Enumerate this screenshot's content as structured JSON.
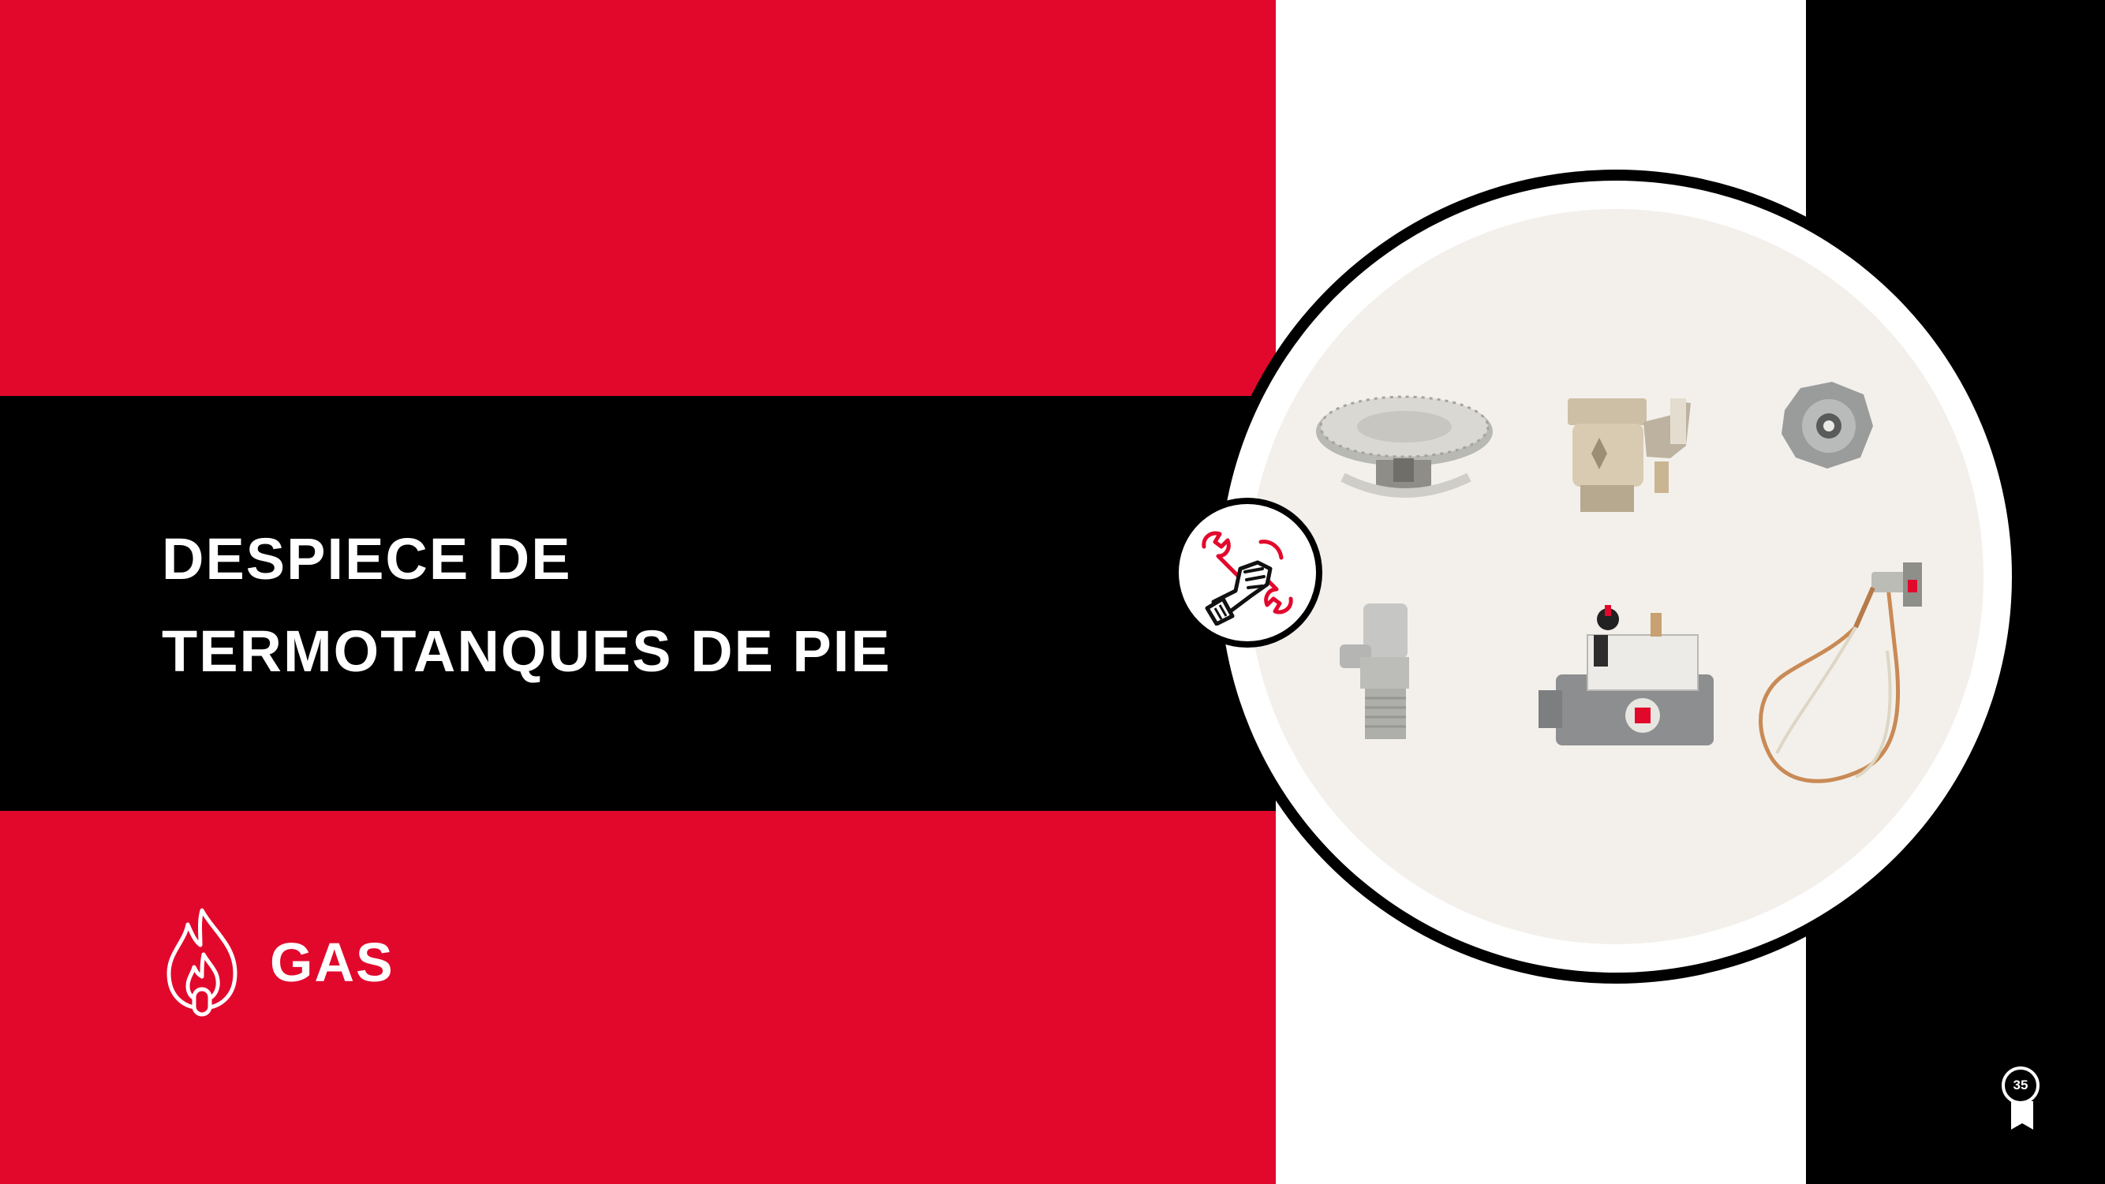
{
  "slide": {
    "title_line1": "DESPIECE DE",
    "title_line2": "TERMOTANQUES DE PIE",
    "category_label": "GAS",
    "page_number": "35"
  },
  "colors": {
    "brand_red": "#e2082c",
    "black": "#000000",
    "white": "#ffffff",
    "photo_background": "#f3f0eb"
  },
  "icons": {
    "category": "flame-icon",
    "badge": "hand-wrench-icon",
    "page_marker": "award-ribbon-icon"
  }
}
